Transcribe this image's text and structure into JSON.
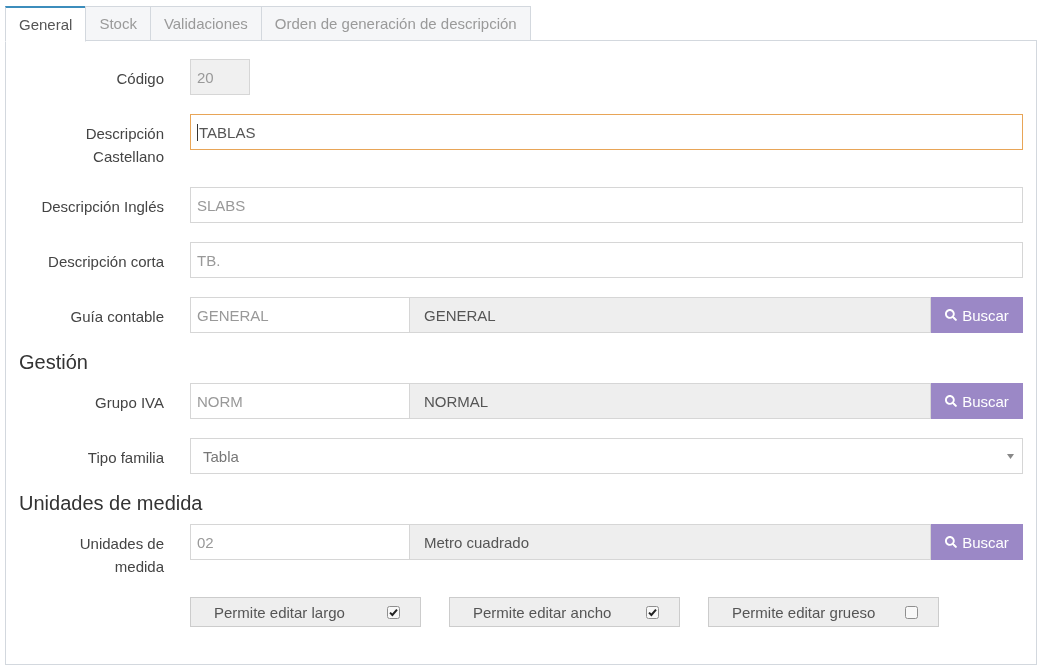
{
  "tabs": [
    {
      "label": "General",
      "selected": true
    },
    {
      "label": "Stock",
      "selected": false
    },
    {
      "label": "Validaciones",
      "selected": false
    },
    {
      "label": "Orden de generación de descripción",
      "selected": false
    }
  ],
  "sections": [
    {
      "fields": [
        {
          "kind": "code",
          "label": "Código",
          "value": "20",
          "disabled": true,
          "focused": false
        },
        {
          "kind": "text",
          "label": "Descripción Castellano",
          "value": "TABLAS",
          "disabled": false,
          "focused": true
        },
        {
          "kind": "text",
          "label": "Descripción Inglés",
          "value": "SLABS",
          "disabled": false,
          "focused": false
        },
        {
          "kind": "text",
          "label": "Descripción corta",
          "value": "TB.",
          "disabled": false,
          "focused": false
        },
        {
          "kind": "lookup",
          "label": "Guía contable",
          "code": "GENERAL",
          "description": "GENERAL",
          "button": "Buscar"
        }
      ]
    },
    {
      "heading": "Gestión",
      "fields": [
        {
          "kind": "lookup",
          "label": "Grupo IVA",
          "code": "NORM",
          "description": "NORMAL",
          "button": "Buscar"
        },
        {
          "kind": "select",
          "label": "Tipo familia",
          "value": "Tabla"
        }
      ]
    },
    {
      "heading": "Unidades de medida",
      "fields": [
        {
          "kind": "lookup",
          "label": "Unidades de medida",
          "code": "02",
          "description": "Metro cuadrado",
          "button": "Buscar"
        }
      ],
      "options": [
        {
          "label": "Permite editar largo",
          "checked": true
        },
        {
          "label": "Permite editar ancho",
          "checked": true
        },
        {
          "label": "Permite editar grueso",
          "checked": false
        }
      ]
    }
  ]
}
